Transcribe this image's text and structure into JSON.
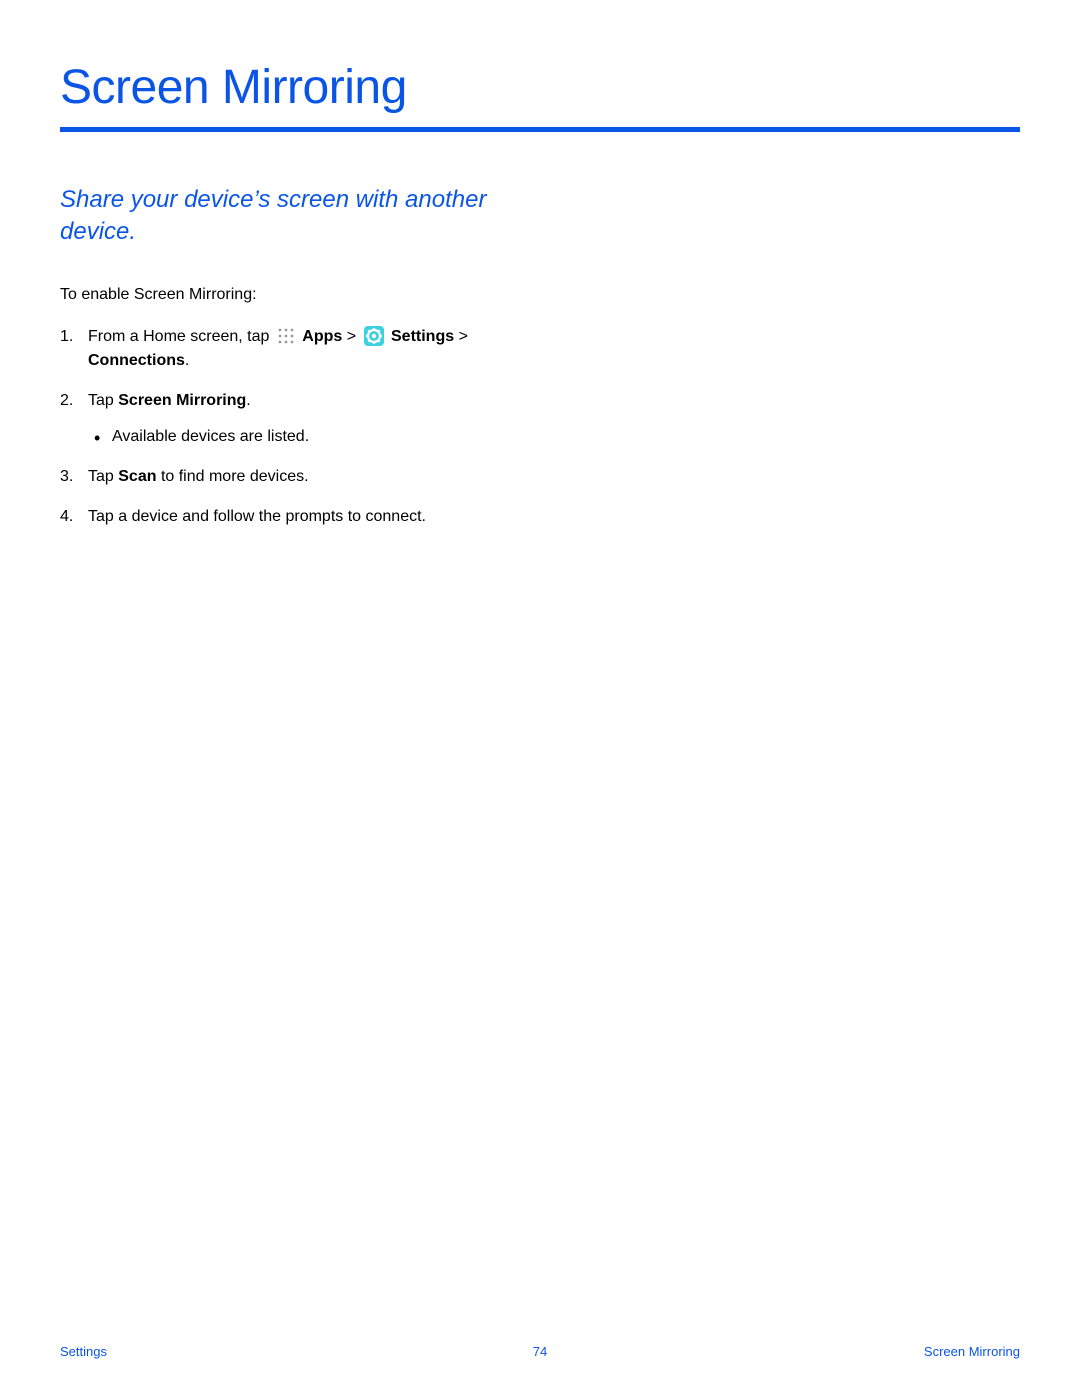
{
  "title": "Screen Mirroring",
  "subtitle": "Share your device’s screen with another device.",
  "intro": "To enable Screen Mirroring:",
  "steps": {
    "s1": {
      "prefix": "From a Home screen, tap ",
      "apps": "Apps",
      "gt": " > ",
      "settings": "Settings",
      "suffix": " > ",
      "conn": "Connections",
      "end": "."
    },
    "s2": {
      "prefix": "Tap ",
      "bold": "Screen Mirroring",
      "end": ".",
      "bullet": "Available devices are listed."
    },
    "s3": {
      "prefix": "Tap ",
      "bold": "Scan",
      "suffix": " to find more devices."
    },
    "s4": "Tap a device and follow the prompts to connect."
  },
  "footer": {
    "left": "Settings",
    "center": "74",
    "right": "Screen Mirroring"
  }
}
